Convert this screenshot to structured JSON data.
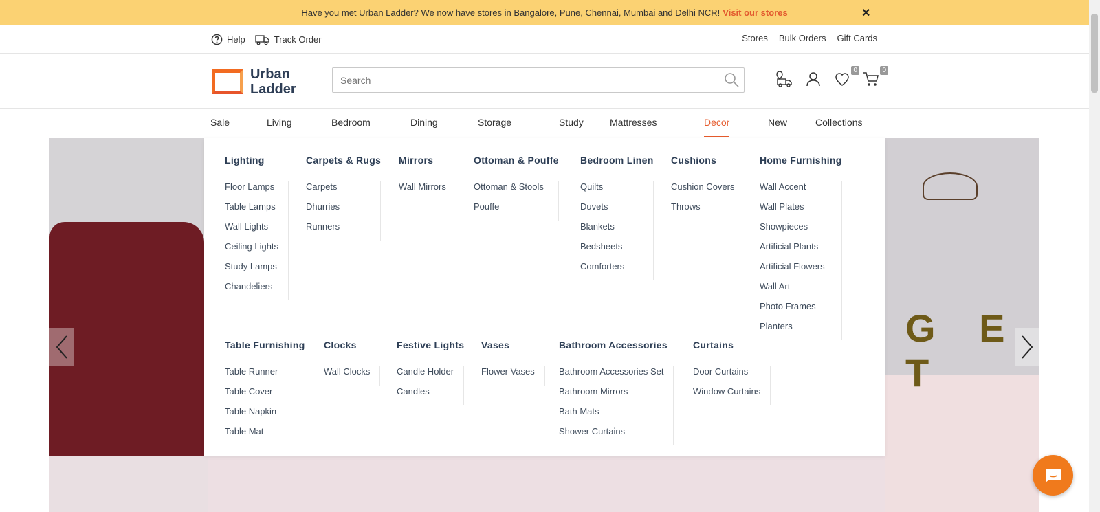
{
  "announcement": {
    "text": "Have you met Urban Ladder? We now have stores in Bangalore, Pune, Chennai, Mumbai and Delhi NCR!",
    "link": "Visit our stores",
    "close": "✕"
  },
  "utility": {
    "help": "Help",
    "track_order": "Track Order",
    "stores": "Stores",
    "bulk_orders": "Bulk Orders",
    "gift_cards": "Gift Cards"
  },
  "logo": {
    "line1": "Urban",
    "line2": "Ladder"
  },
  "search": {
    "placeholder": "Search",
    "value": ""
  },
  "header_icons": {
    "wishlist_count": "0",
    "cart_count": "0"
  },
  "nav": [
    {
      "label": "Sale"
    },
    {
      "label": "Living"
    },
    {
      "label": "Bedroom"
    },
    {
      "label": "Dining"
    },
    {
      "label": "Storage"
    },
    {
      "label": "Study"
    },
    {
      "label": "Mattresses"
    },
    {
      "label": "Decor",
      "active": true
    },
    {
      "label": "New"
    },
    {
      "label": "Collections"
    }
  ],
  "mega_menu": {
    "row1": [
      {
        "heading": "Lighting",
        "items": [
          "Floor Lamps",
          "Table Lamps",
          "Wall Lights",
          "Ceiling Lights",
          "Study Lamps",
          "Chandeliers"
        ]
      },
      {
        "heading": "Carpets & Rugs",
        "items": [
          "Carpets",
          "Dhurries",
          "Runners"
        ]
      },
      {
        "heading": "Mirrors",
        "items": [
          "Wall Mirrors"
        ]
      },
      {
        "heading": "Ottoman & Pouffe",
        "items": [
          "Ottoman & Stools",
          "Pouffe"
        ]
      },
      {
        "heading": "Bedroom Linen",
        "items": [
          "Quilts",
          "Duvets",
          "Blankets",
          "Bedsheets",
          "Comforters"
        ]
      },
      {
        "heading": "Cushions",
        "items": [
          "Cushion Covers",
          "Throws"
        ]
      },
      {
        "heading": "Home Furnishing",
        "items": [
          "Wall Accent",
          "Wall Plates",
          "Showpieces",
          "Artificial Plants",
          "Artificial Flowers",
          "Wall Art",
          "Photo Frames",
          "Planters"
        ]
      }
    ],
    "row2": [
      {
        "heading": "Table Furnishing",
        "items": [
          "Table Runner",
          "Table Cover",
          "Table Napkin",
          "Table Mat"
        ]
      },
      {
        "heading": "Clocks",
        "items": [
          "Wall Clocks"
        ]
      },
      {
        "heading": "Festive Lights",
        "items": [
          "Candle Holder",
          "Candles"
        ]
      },
      {
        "heading": "Vases",
        "items": [
          "Flower Vases"
        ]
      },
      {
        "heading": "Bathroom Accessories",
        "items": [
          "Bathroom Accessories Set",
          "Bathroom Mirrors",
          "Bath Mats",
          "Shower Curtains"
        ]
      },
      {
        "heading": "Curtains",
        "items": [
          "Door Curtains",
          "Window Curtains"
        ]
      }
    ]
  },
  "banner": {
    "overlay_text": "G E T"
  }
}
